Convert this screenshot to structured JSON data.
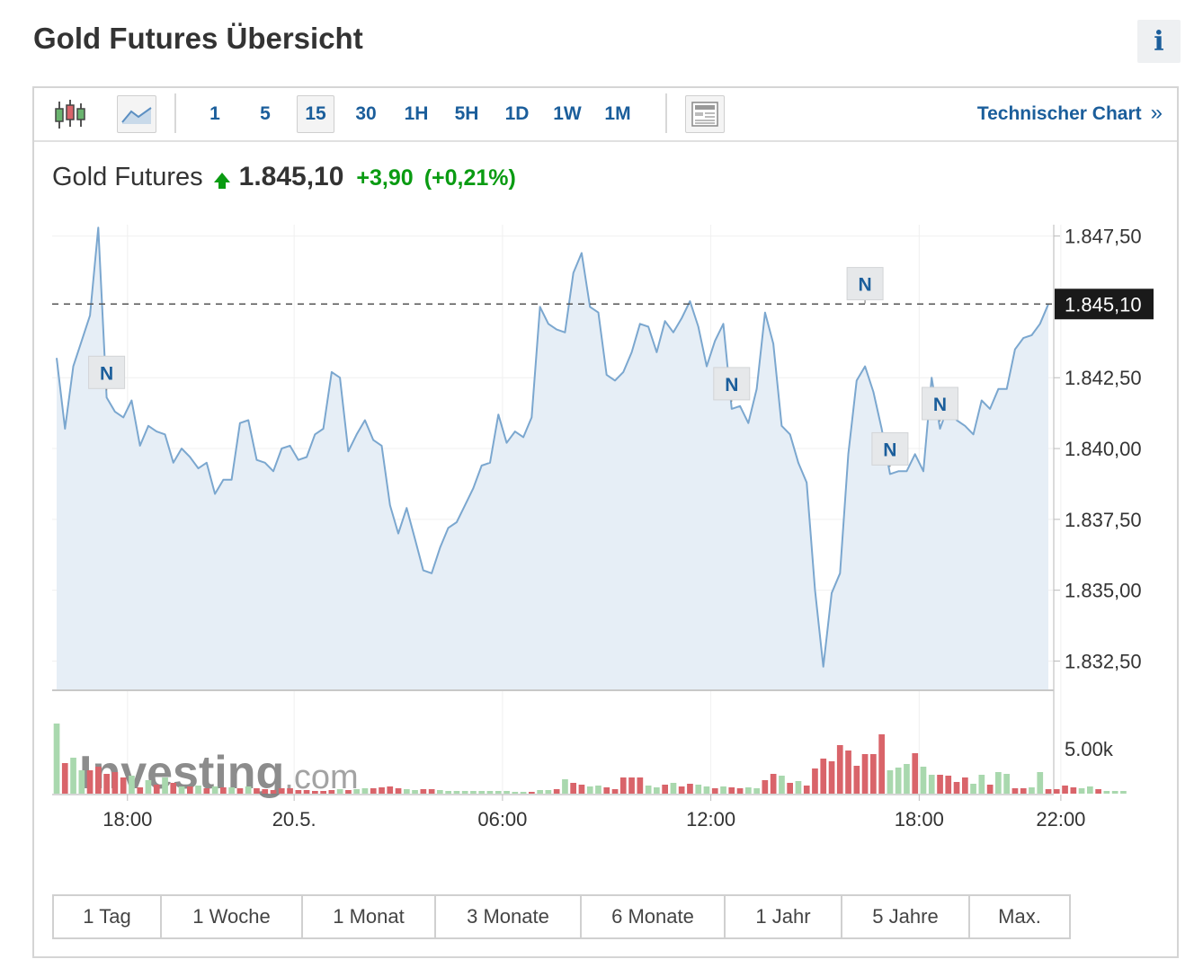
{
  "page": {
    "title": "Gold Futures Übersicht",
    "info_label": "i"
  },
  "toolbar": {
    "candles_icon": "candlestick-icon",
    "area_icon": "area-chart-icon",
    "intervals": [
      {
        "label": "1",
        "active": false
      },
      {
        "label": "5",
        "active": false
      },
      {
        "label": "15",
        "active": true
      },
      {
        "label": "30",
        "active": false
      },
      {
        "label": "1H",
        "active": false
      },
      {
        "label": "5H",
        "active": false
      },
      {
        "label": "1D",
        "active": false
      },
      {
        "label": "1W",
        "active": false
      },
      {
        "label": "1M",
        "active": false
      }
    ],
    "layout_icon": "news-layout-icon",
    "tech_chart_label": "Technischer Chart",
    "tech_chart_arrow": "»"
  },
  "quote": {
    "name": "Gold Futures",
    "direction": "up",
    "price": "1.845,10",
    "change": "+3,90",
    "change_pct": "(+0,21%)"
  },
  "ranges": [
    "1 Tag",
    "1 Woche",
    "1 Monat",
    "3 Monate",
    "6 Monate",
    "1 Jahr",
    "5 Jahre",
    "Max."
  ],
  "colors": {
    "line": "#7ba7cf",
    "area": "#e6eef6",
    "up_volume": "#a9d8ae",
    "down_volume": "#d9646a",
    "accent": "#1b5e9b",
    "positive": "#0a9b12"
  },
  "chart_data": {
    "type": "area",
    "ylim": [
      1831.5,
      1847.9
    ],
    "y_ticks": [
      "1.847,50",
      "1.842,50",
      "1.840,00",
      "1.837,50",
      "1.835,00",
      "1.832,50"
    ],
    "y_tick_values": [
      1847.5,
      1842.5,
      1840.0,
      1837.5,
      1835.0,
      1832.5
    ],
    "x_ticks": [
      {
        "label": "18:00",
        "index": 8.5
      },
      {
        "label": "20.5.",
        "index": 28.5
      },
      {
        "label": "06:00",
        "index": 53.5
      },
      {
        "label": "12:00",
        "index": 78.5
      },
      {
        "label": "18:00",
        "index": 103.5
      },
      {
        "label": "22:00",
        "index": 120.5
      }
    ],
    "last_price": 1845.1,
    "last_price_label": "1.845,10",
    "series": [
      {
        "values": [
          1843.2,
          1840.7,
          1842.9,
          1843.8,
          1844.7,
          1847.8,
          1841.8,
          1841.3,
          1841.1,
          1841.7,
          1840.1,
          1840.8,
          1840.6,
          1840.5,
          1839.5,
          1840.0,
          1839.7,
          1839.3,
          1839.5,
          1838.4,
          1838.9,
          1838.9,
          1840.9,
          1841.0,
          1839.6,
          1839.5,
          1839.2,
          1840.0,
          1840.1,
          1839.6,
          1839.7,
          1840.5,
          1840.7,
          1842.7,
          1842.5,
          1839.9,
          1840.5,
          1841.0,
          1840.3,
          1840.1,
          1838.0,
          1837.0,
          1837.9,
          1836.8,
          1835.7,
          1835.6,
          1836.5,
          1837.2,
          1837.4,
          1838.0,
          1838.6,
          1839.4,
          1839.5,
          1841.2,
          1840.2,
          1840.6,
          1840.4,
          1841.1,
          1845.0,
          1844.4,
          1844.2,
          1844.1,
          1846.2,
          1846.9,
          1845.0,
          1844.8,
          1842.6,
          1842.4,
          1842.7,
          1843.4,
          1844.4,
          1844.3,
          1843.4,
          1844.5,
          1844.1,
          1844.6,
          1845.2,
          1844.3,
          1842.9,
          1843.8,
          1844.4,
          1841.4,
          1841.5,
          1840.9,
          1842.1,
          1844.8,
          1843.7,
          1840.8,
          1840.5,
          1839.5,
          1838.8,
          1835.0,
          1832.3,
          1834.9,
          1835.6,
          1839.8,
          1842.4,
          1842.9,
          1842.0,
          1840.7,
          1839.1,
          1839.2,
          1839.2,
          1839.8,
          1839.2,
          1842.5,
          1840.7,
          1841.5,
          1841.0,
          1840.8,
          1840.5,
          1841.7,
          1841.4,
          1842.1,
          1842.1,
          1843.5,
          1843.9,
          1844.0,
          1844.4,
          1845.1
        ]
      }
    ],
    "volume": {
      "tick_label": "5.00k",
      "values": [
        7.8,
        3.4,
        4.0,
        2.6,
        2.6,
        3.0,
        2.2,
        2.4,
        1.8,
        2.0,
        0.7,
        1.5,
        1.0,
        1.8,
        1.2,
        0.8,
        0.8,
        0.9,
        0.6,
        0.8,
        0.7,
        0.7,
        0.6,
        0.8,
        0.6,
        0.5,
        0.4,
        0.6,
        0.6,
        0.4,
        0.4,
        0.3,
        0.3,
        0.4,
        0.5,
        0.4,
        0.5,
        0.6,
        0.6,
        0.7,
        0.8,
        0.6,
        0.5,
        0.4,
        0.5,
        0.5,
        0.4,
        0.3,
        0.3,
        0.3,
        0.3,
        0.3,
        0.3,
        0.3,
        0.3,
        0.2,
        0.2,
        0.2,
        0.4,
        0.4,
        0.5,
        1.6,
        1.2,
        1.0,
        0.8,
        0.9,
        0.7,
        0.5,
        1.8,
        1.8,
        1.8,
        0.9,
        0.7,
        1.0,
        1.2,
        0.8,
        1.1,
        1.0,
        0.8,
        0.6,
        0.8,
        0.7,
        0.6,
        0.7,
        0.6,
        1.5,
        2.2,
        2.0,
        1.2,
        1.4,
        0.9,
        2.8,
        3.9,
        3.6,
        5.4,
        4.8,
        3.1,
        4.4,
        4.4,
        6.6,
        2.6,
        2.9,
        3.3,
        4.5,
        3.0,
        2.1,
        2.1,
        2.0,
        1.3,
        1.8,
        1.1,
        2.1,
        1.0,
        2.4,
        2.2,
        0.6,
        0.6,
        0.7,
        2.4,
        0.5,
        0.5,
        0.9,
        0.7,
        0.6,
        0.8,
        0.5,
        0.3,
        0.3,
        0.3
      ],
      "direction": [
        "u",
        "d",
        "u",
        "u",
        "d",
        "d",
        "d",
        "d",
        "d",
        "u",
        "d",
        "u",
        "d",
        "u",
        "d",
        "u",
        "d",
        "u",
        "d",
        "u",
        "d",
        "u",
        "d",
        "u",
        "d",
        "d",
        "d",
        "d",
        "d",
        "d",
        "d",
        "d",
        "d",
        "d",
        "u",
        "d",
        "u",
        "u",
        "d",
        "d",
        "d",
        "d",
        "u",
        "u",
        "d",
        "d",
        "u",
        "u",
        "u",
        "u",
        "u",
        "u",
        "u",
        "u",
        "u",
        "u",
        "u",
        "d",
        "u",
        "u",
        "d",
        "u",
        "d",
        "d",
        "u",
        "u",
        "d",
        "d",
        "d",
        "d",
        "d",
        "u",
        "u",
        "d",
        "u",
        "d",
        "d",
        "u",
        "u",
        "d",
        "u",
        "d",
        "d",
        "u",
        "u",
        "d",
        "d",
        "u",
        "d",
        "u",
        "d",
        "d",
        "d",
        "d",
        "d",
        "d",
        "d",
        "d",
        "d",
        "d",
        "u",
        "u",
        "u",
        "d",
        "u",
        "u",
        "d",
        "d",
        "d",
        "d",
        "u",
        "u",
        "d",
        "u",
        "u",
        "d",
        "d",
        "u",
        "u",
        "d",
        "d",
        "d",
        "d",
        "u",
        "u",
        "d",
        "u",
        "u",
        "u"
      ]
    },
    "news_markers": [
      {
        "label": "N",
        "index": 6
      },
      {
        "label": "N",
        "index": 81
      },
      {
        "label": "N",
        "index": 97
      },
      {
        "label": "N",
        "index": 100
      },
      {
        "label": "N",
        "index": 106
      }
    ]
  }
}
